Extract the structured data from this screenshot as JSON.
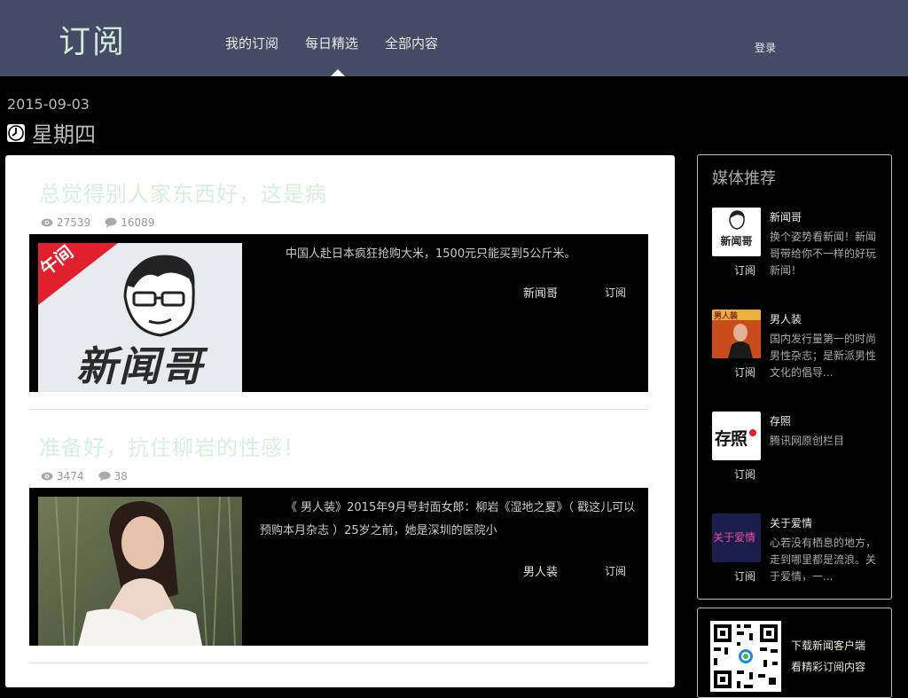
{
  "header": {
    "logo": "订阅",
    "nav": [
      "我的订阅",
      "每日精选",
      "全部内容"
    ],
    "login": "登录"
  },
  "date": "2015-09-03",
  "weekday": "星期四",
  "articles": [
    {
      "title": "总觉得别人家东西好，这是病",
      "views": "27539",
      "comments": "16089",
      "excerpt": "中国人赴日本疯狂抢购大米，1500元只能买到5公斤米。",
      "source": "新闻哥",
      "subscribe": "订阅"
    },
    {
      "title": "准备好，抗住柳岩的性感！",
      "views": "3474",
      "comments": "38",
      "excerpt": "《 男人装》2015年9月号封面女郎：柳岩《湿地之夏》（ 戳这儿可以预购本月杂志 ）25岁之前，她是深圳的医院小",
      "source": "男人装",
      "subscribe": "订阅"
    }
  ],
  "thumb1": {
    "corner_text": "午间",
    "logo_text": "新闻哥"
  },
  "sidebar": {
    "title": "媒体推荐",
    "media": [
      {
        "name": "新闻哥",
        "desc": "换个姿势看新闻！新闻哥带给你不一样的好玩新闻！",
        "subscribe": "订阅",
        "logo_text": "新闻哥"
      },
      {
        "name": "男人装",
        "desc": "国内发行量第一的时尚男性杂志；是新派男性文化的倡导...",
        "subscribe": "订阅",
        "logo_text": "男人装"
      },
      {
        "name": "存照",
        "desc": "腾讯网原创栏目",
        "subscribe": "订阅",
        "logo_text": "存照"
      },
      {
        "name": "关于爱情",
        "desc": "心若没有栖息的地方，走到哪里都是流浪。关于爱情，一...",
        "subscribe": "订阅",
        "logo_text": "关于爱情"
      }
    ]
  },
  "download": {
    "line1": "下载新闻客户端",
    "line2": "看精彩订阅内容"
  },
  "colors": {
    "header_bg": "#434b66",
    "title_green": "#d6f0de",
    "red_ribbon": "#e0202c"
  }
}
